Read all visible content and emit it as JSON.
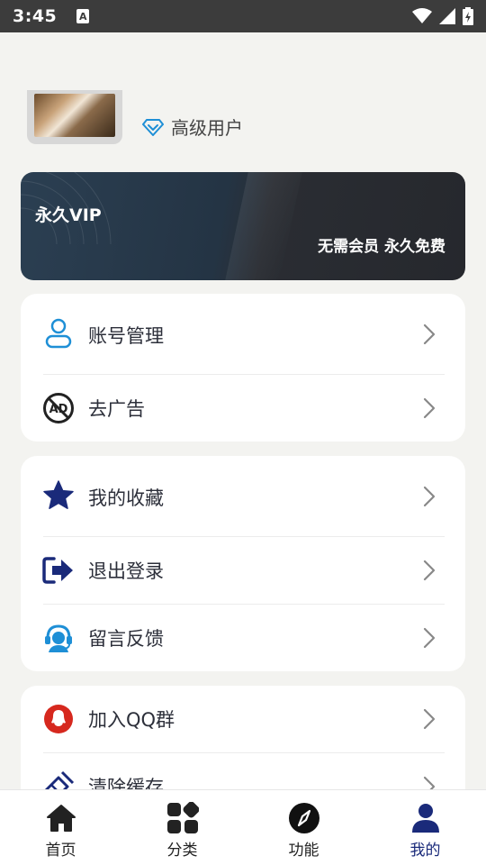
{
  "status_bar": {
    "time": "3:45",
    "a_badge": "A"
  },
  "profile": {
    "level_label": "高级用户"
  },
  "vip": {
    "title": "永久VIP",
    "subtitle": "无需会员 永久免费"
  },
  "menu_groups": [
    {
      "items": [
        {
          "label": "账号管理",
          "icon": "user-icon"
        },
        {
          "label": "去广告",
          "icon": "no-ad-icon"
        }
      ]
    },
    {
      "items": [
        {
          "label": "我的收藏",
          "icon": "star-icon"
        },
        {
          "label": "退出登录",
          "icon": "logout-icon"
        },
        {
          "label": "留言反馈",
          "icon": "support-icon"
        }
      ]
    },
    {
      "items": [
        {
          "label": "加入QQ群",
          "icon": "qq-icon"
        },
        {
          "label": "清除缓存",
          "icon": "broom-icon"
        }
      ]
    }
  ],
  "bottom_nav": [
    {
      "label": "首页",
      "icon": "home-icon"
    },
    {
      "label": "分类",
      "icon": "category-icon"
    },
    {
      "label": "功能",
      "icon": "compass-icon"
    },
    {
      "label": "我的",
      "icon": "profile-icon",
      "active": true
    }
  ],
  "colors": {
    "accent": "#1a2a7a",
    "vip_bg": "#26282d",
    "background": "#f3f3f0"
  }
}
